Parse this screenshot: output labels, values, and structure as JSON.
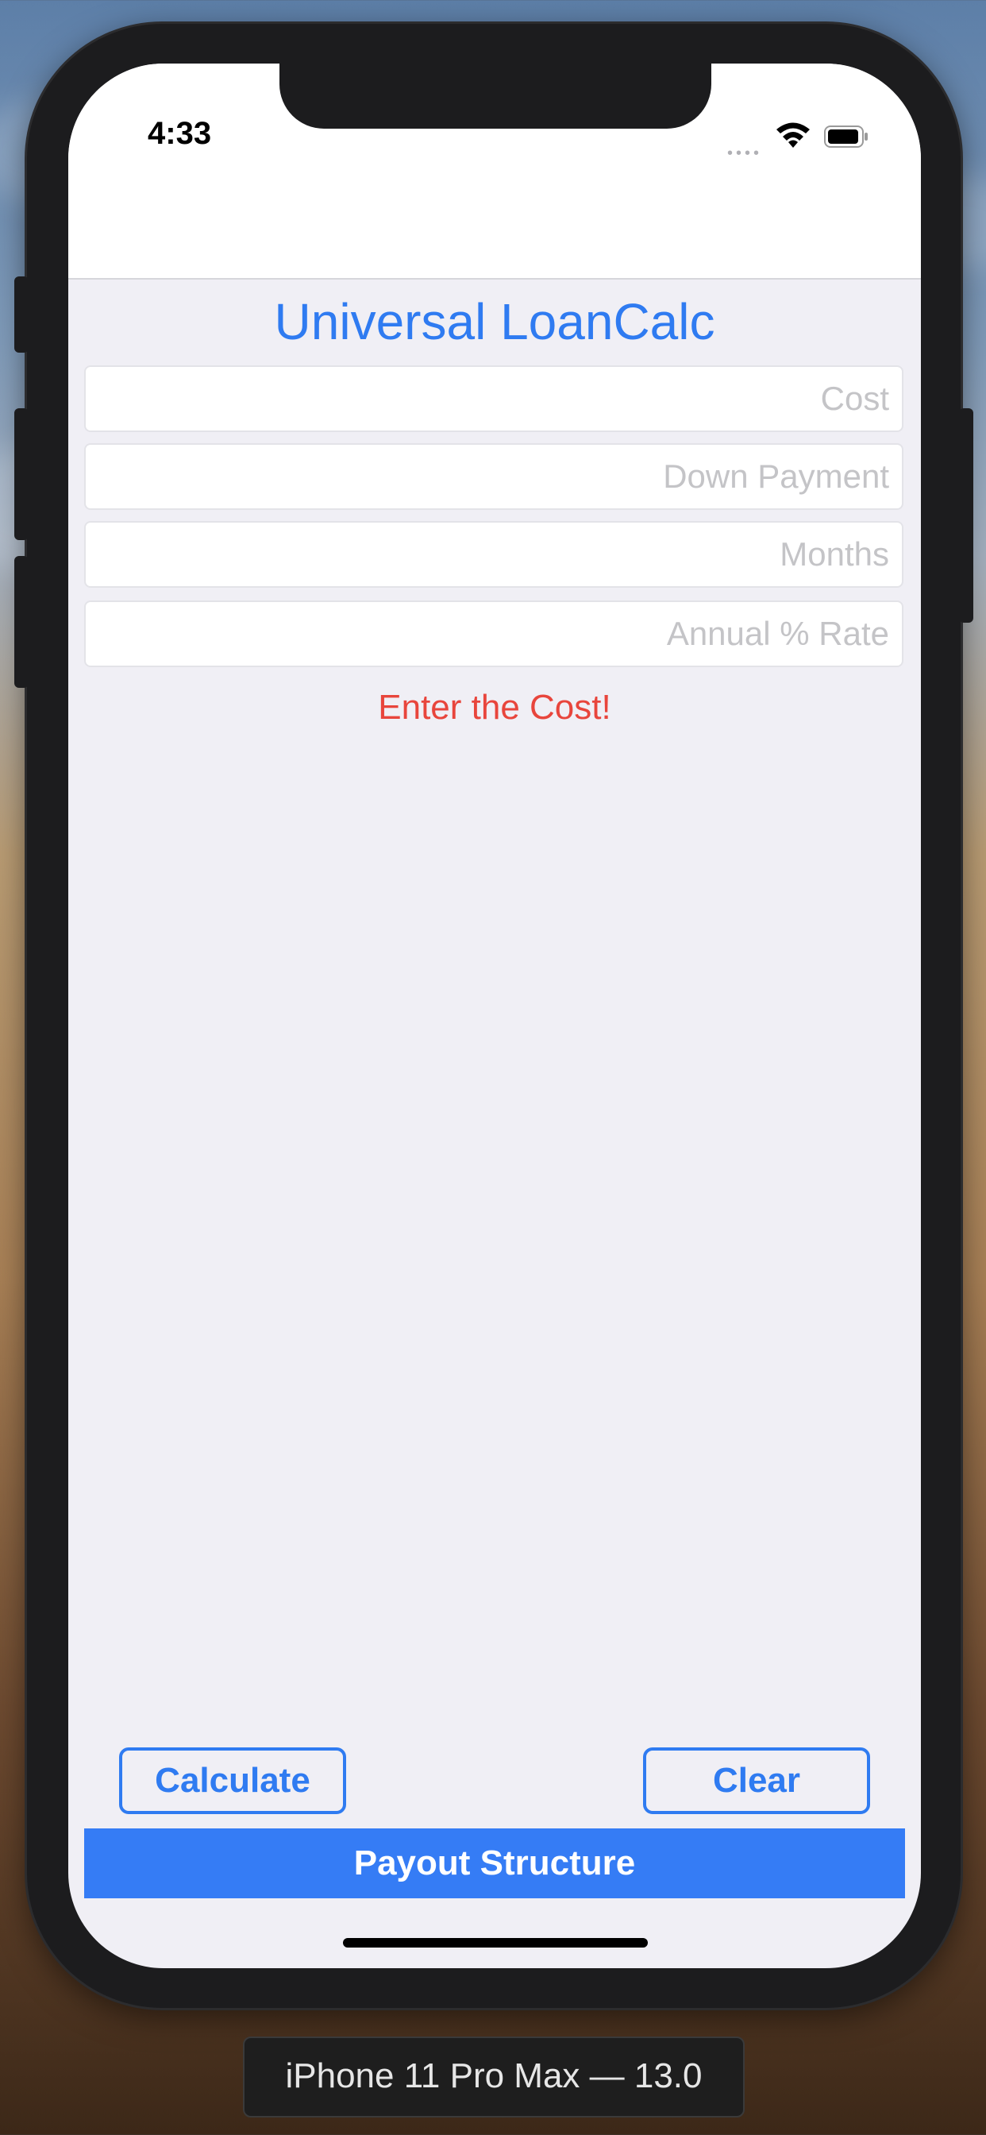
{
  "status_bar": {
    "time": "4:33"
  },
  "app": {
    "title": "Universal LoanCalc",
    "fields": {
      "cost": {
        "value": "",
        "placeholder": "Cost"
      },
      "down_payment": {
        "value": "",
        "placeholder": "Down Payment"
      },
      "months": {
        "value": "",
        "placeholder": "Months"
      },
      "annual_rate": {
        "value": "",
        "placeholder": "Annual % Rate"
      }
    },
    "error_message": "Enter the Cost!",
    "buttons": {
      "calculate": "Calculate",
      "clear": "Clear",
      "payout_structure": "Payout Structure"
    }
  },
  "simulator": {
    "device_label": "iPhone 11 Pro Max — 13.0"
  },
  "colors": {
    "accent": "#2f7bf1",
    "payout_bg": "#357cf5",
    "error": "#e8453c",
    "screen_bg": "#f0eff5",
    "placeholder": "#c4c4c7"
  },
  "icons": [
    "cellular-signal-icon",
    "wifi-icon",
    "battery-icon"
  ]
}
